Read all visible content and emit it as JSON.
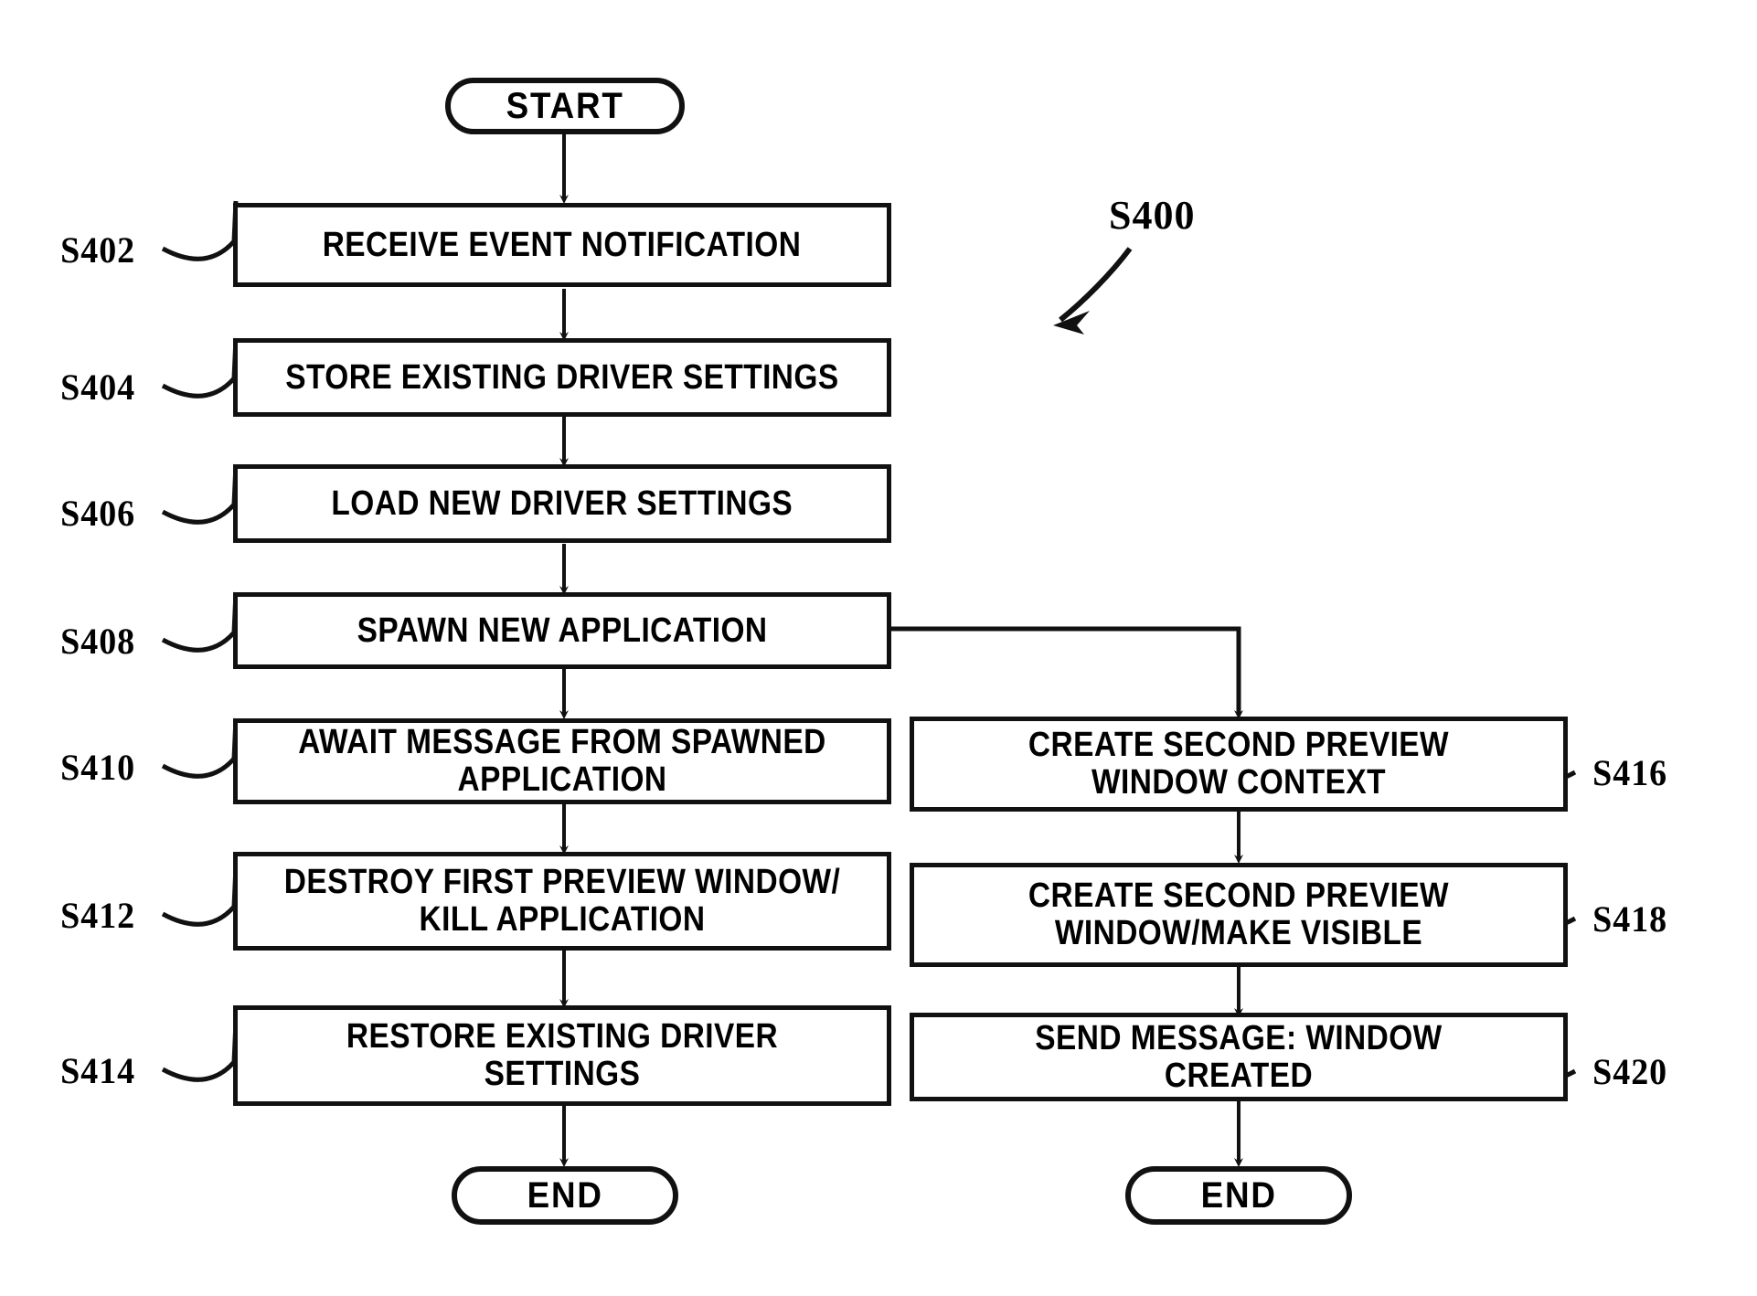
{
  "figure": {
    "reference_label": "S400",
    "background_color": "#ffffff",
    "ink_color": "#000000",
    "type": "flowchart"
  },
  "nodes": {
    "start_left": {
      "label": "START",
      "shape": "terminal"
    },
    "s402": {
      "label": "RECEIVE EVENT NOTIFICATION",
      "shape": "process",
      "ref": "S402"
    },
    "s404": {
      "label": "STORE EXISTING DRIVER SETTINGS",
      "shape": "process",
      "ref": "S404"
    },
    "s406": {
      "label": "LOAD NEW DRIVER SETTINGS",
      "shape": "process",
      "ref": "S406"
    },
    "s408": {
      "label": "SPAWN NEW APPLICATION",
      "shape": "process",
      "ref": "S408"
    },
    "s410": {
      "label": "AWAIT MESSAGE FROM SPAWNED APPLICATION",
      "shape": "process",
      "ref": "S410"
    },
    "s412": {
      "label": "DESTROY FIRST PREVIEW WINDOW/ KILL APPLICATION",
      "shape": "process",
      "ref": "S412"
    },
    "s414": {
      "label": "RESTORE EXISTING DRIVER SETTINGS",
      "shape": "process",
      "ref": "S414"
    },
    "end_left": {
      "label": "END",
      "shape": "terminal"
    },
    "s416": {
      "label": "CREATE SECOND PREVIEW WINDOW CONTEXT",
      "shape": "process",
      "ref": "S416"
    },
    "s418": {
      "label": "CREATE SECOND PREVIEW WINDOW/MAKE VISIBLE",
      "shape": "process",
      "ref": "S418"
    },
    "s420": {
      "label": "SEND MESSAGE: WINDOW CREATED",
      "shape": "process",
      "ref": "S420"
    },
    "end_right": {
      "label": "END",
      "shape": "terminal"
    }
  },
  "step_refs": {
    "s402": "S402",
    "s404": "S404",
    "s406": "S406",
    "s408": "S408",
    "s410": "S410",
    "s412": "S412",
    "s414": "S414",
    "s416": "S416",
    "s418": "S418",
    "s420": "S420"
  },
  "edges": [
    {
      "from": "start_left",
      "to": "s402",
      "kind": "arrow-down"
    },
    {
      "from": "s402",
      "to": "s404",
      "kind": "arrow-down"
    },
    {
      "from": "s404",
      "to": "s406",
      "kind": "arrow-down"
    },
    {
      "from": "s406",
      "to": "s408",
      "kind": "arrow-down"
    },
    {
      "from": "s408",
      "to": "s410",
      "kind": "arrow-down"
    },
    {
      "from": "s408",
      "to": "s416",
      "kind": "branch-right-down"
    },
    {
      "from": "s410",
      "to": "s412",
      "kind": "arrow-down"
    },
    {
      "from": "s412",
      "to": "s414",
      "kind": "arrow-down"
    },
    {
      "from": "s414",
      "to": "end_left",
      "kind": "arrow-down"
    },
    {
      "from": "s416",
      "to": "s418",
      "kind": "arrow-down"
    },
    {
      "from": "s418",
      "to": "s420",
      "kind": "arrow-down"
    },
    {
      "from": "s420",
      "to": "end_right",
      "kind": "arrow-down"
    }
  ]
}
